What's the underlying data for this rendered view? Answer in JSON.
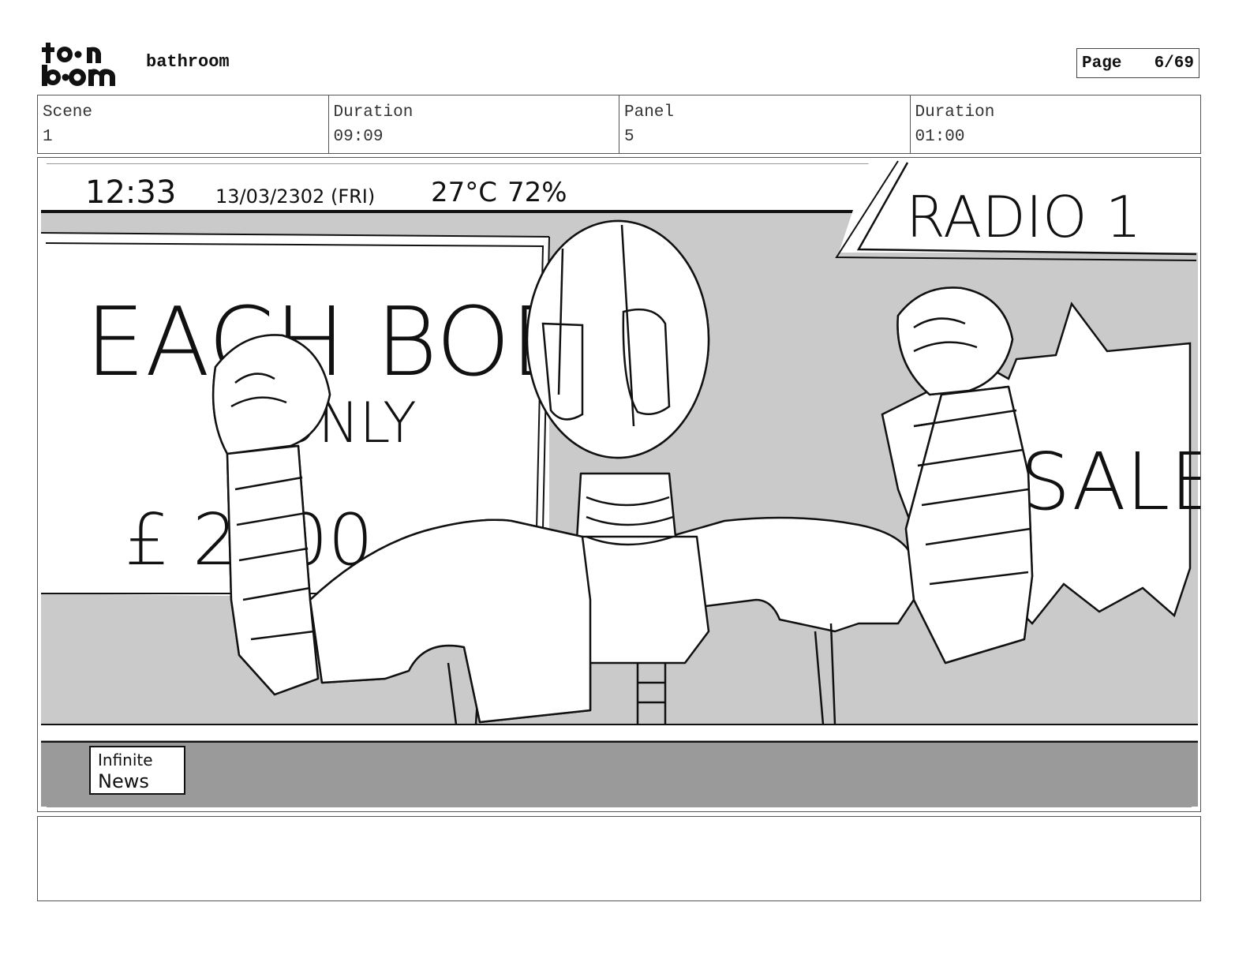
{
  "header": {
    "logo_top": "toon",
    "logo_bottom": "boom",
    "title": "bathroom",
    "page_label": "Page",
    "page_value": "6/69"
  },
  "info": [
    {
      "label": "Scene",
      "value": "1"
    },
    {
      "label": "Duration",
      "value": "09:09"
    },
    {
      "label": "Panel",
      "value": "5"
    },
    {
      "label": "Duration",
      "value": "01:00"
    }
  ],
  "panel": {
    "ticker_time": "12:33",
    "ticker_date": "13/03/2302 (FRI)",
    "ticker_temp": "27°C",
    "ticker_humidity": "72%",
    "station": "RADIO 1",
    "billboard_line1": "EACH BODY",
    "billboard_line2": "ONLY",
    "billboard_line3": "£ 2000",
    "burst_text": "SALE",
    "news_line1": "Infinite",
    "news_line2": "News"
  },
  "caption": ""
}
